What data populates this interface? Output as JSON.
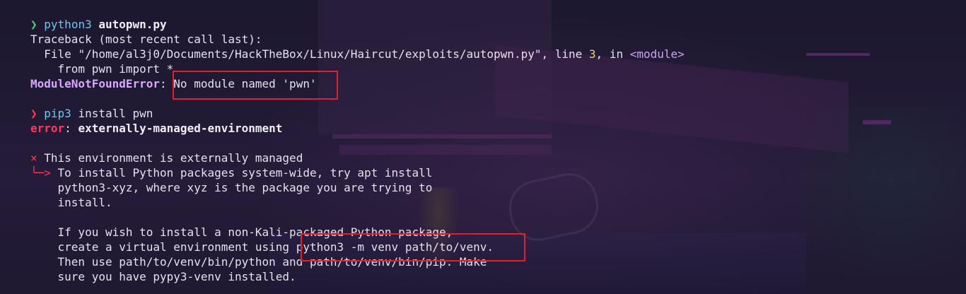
{
  "terminal": {
    "block1": {
      "prompt_symbol": "❯",
      "command": "python3",
      "argument": "autopwn.py",
      "traceback_header": "Traceback (most recent call last):",
      "file_prefix": "  File ",
      "file_path": "\"/home/al3j0/Documents/HackTheBox/Linux/Haircut/exploits/autopwn.py\"",
      "file_line_label": ", line ",
      "file_line_number": "3",
      "file_in": ", in ",
      "file_module": "<module>",
      "source_line": "    from pwn import *",
      "error_name": "ModuleNotFoundError",
      "error_colon": ": ",
      "error_message": "No module named 'pwn'"
    },
    "block2": {
      "prompt_symbol": "❯",
      "command": "pip3",
      "arguments": " install pwn",
      "error_label": "error",
      "error_colon": ": ",
      "error_message": "externally-managed-environment",
      "cross_symbol": "×",
      "headline": " This environment is externally managed",
      "arrow_symbol": "╰─>",
      "para1_line1": " To install Python packages system-wide, try apt install",
      "para1_line2": "    python3-xyz, where xyz is the package you are trying to",
      "para1_line3": "    install.",
      "para2_line1": "    If you wish to install a non-Kali-packaged Python package,",
      "para2_line2_prefix": "    create a virtual environment using ",
      "para2_line2_cmd": "python3 -m venv path/to/venv.",
      "para2_line3": "    Then use path/to/venv/bin/python and path/to/venv/bin/pip. Make",
      "para2_line4": "    sure you have pypy3-venv installed."
    }
  },
  "colors": {
    "prompt_ok": "#4fd17a",
    "prompt_err": "#ff3a5c",
    "command": "#6ac9ef",
    "highlight_box": "#e41e2c"
  }
}
